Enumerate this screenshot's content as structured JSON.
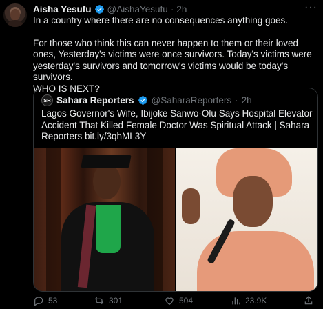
{
  "tweet": {
    "author_name": "Aisha Yesufu",
    "author_handle": "@AishaYesufu",
    "separator": "·",
    "time": "2h",
    "more": "···",
    "lines": [
      "In a country where there are no consequences anything goes.",
      "For those who think this can never happen to them or their loved ones, Yesterday's victims were once survivors. Today's victims were yesterday's survivors and tomorrow's victims would be today's survivors.",
      "WHO IS NEXT?"
    ]
  },
  "quote": {
    "logo_text": "SR",
    "author_name": "Sahara Reporters",
    "author_handle": "@SaharaReporters",
    "separator": "·",
    "time": "2h",
    "text": "Lagos Governor's Wife, Ibijoke Sanwo-Olu Says Hospital Elevator Accident That Killed Female Doctor Was Spiritual Attack | Sahara Reporters bit.ly/3qhML3Y"
  },
  "actions": {
    "replies": "53",
    "reposts": "301",
    "likes": "504",
    "views": "23.9K"
  },
  "colors": {
    "background": "#000000",
    "text": "#e7e9ea",
    "muted": "#71767b",
    "border": "#2f3336",
    "verified": "#1d9bf0"
  }
}
